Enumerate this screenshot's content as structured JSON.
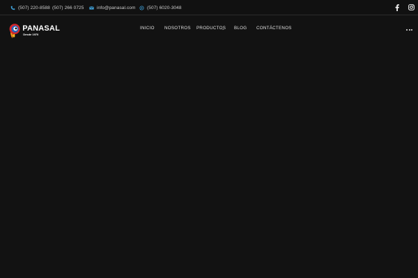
{
  "topbar": {
    "phone1": "(507) 220-8588",
    "phone2": "(507) 266 0725",
    "email": "info@panasal.com",
    "whatsapp": "(507) 6020-3048",
    "icons": {
      "phone": "phone-icon",
      "email": "envelope-icon",
      "whatsapp": "whatsapp-icon",
      "facebook": "facebook-icon",
      "instagram": "instagram-icon"
    },
    "accent": "#3ea0d8"
  },
  "header": {
    "logo": {
      "name": "PANASAL",
      "tagline": "Desde 1970"
    },
    "nav": {
      "inicio": "INICIO",
      "nosotros": "NOSOTROS",
      "productos": "PRODUCTOS",
      "blog": "BLOG",
      "contactenos": "CONTÁCTENOS"
    },
    "dropdown_glyph": "⌄"
  },
  "colors": {
    "background": "#121212",
    "text": "#e2e2e2",
    "logo_red": "#d9262a",
    "logo_blue": "#2a62b8"
  }
}
